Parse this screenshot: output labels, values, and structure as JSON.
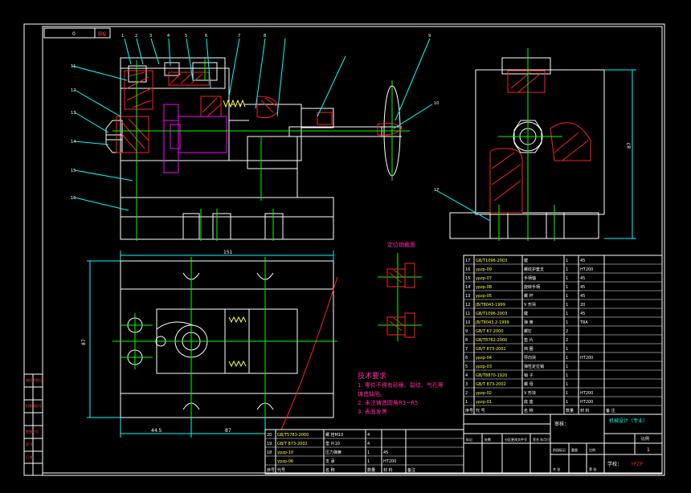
{
  "title_box": {
    "number": "0",
    "label": "图幅"
  },
  "callouts_top": [
    "1",
    "2",
    "3",
    "4",
    "5",
    "6",
    "7",
    "8",
    "9",
    "10",
    "11",
    "12",
    "13",
    "14",
    "15",
    "16",
    "17"
  ],
  "dimensions": {
    "width_main": "151",
    "height_main": "87",
    "height_side": "87",
    "dim_a": "44.5",
    "dim_b": "87"
  },
  "section_label": "定位销截面",
  "tech_req": {
    "title": "技术要求",
    "lines": [
      "1. 零件不得有砂眼、裂纹、气孔等",
      "   铸造缺陷。",
      "2. 未注铸造圆角R3~R5",
      "3. 表面发黑"
    ]
  },
  "parts_table": {
    "rows": [
      [
        "17",
        "GB/T1096-2003",
        "键",
        "1",
        "45",
        ""
      ],
      [
        "16",
        "ypzp-09",
        "螺纹护套支",
        "1",
        "HT200",
        ""
      ],
      [
        "15",
        "ypzp-07",
        "手柄轴",
        "1",
        "45",
        ""
      ],
      [
        "14",
        "ypzp-08",
        "旋转手柄",
        "1",
        "45",
        ""
      ],
      [
        "13",
        "ypzp-05",
        "螺 杆",
        "1",
        "45",
        ""
      ],
      [
        "12",
        "JB/T8043-1999",
        "V 形块",
        "1",
        "20",
        ""
      ],
      [
        "11",
        "GB/T1096-2003",
        "键",
        "1",
        "45",
        ""
      ],
      [
        "10",
        "JB/T8043.2-1999",
        "弹 簧",
        "1",
        "T8A",
        ""
      ],
      [
        "9",
        "GB/T 67-2000",
        "螺钉",
        "2",
        "",
        ""
      ],
      [
        "8",
        "GB/T8782-2000",
        "垫 片",
        "2",
        "",
        ""
      ],
      [
        "7",
        "GB/T 873-2002",
        "挡 圈",
        "1",
        "",
        ""
      ],
      [
        "6",
        "ypzp-04",
        "导向块",
        "1",
        "HT200",
        ""
      ],
      [
        "5",
        "ypzp-03",
        "弹性定位销",
        "1",
        "",
        ""
      ],
      [
        "4",
        "GB/T8870-1920",
        "销 子",
        "1",
        "",
        ""
      ],
      [
        "3",
        "GB/T 873-2002",
        "螺 母",
        "1",
        "",
        ""
      ],
      [
        "2",
        "ypzp-02",
        "V 形块",
        "1",
        "HT200",
        ""
      ],
      [
        "1",
        "ypzp-01",
        "底 座",
        "1",
        "HT200",
        ""
      ]
    ],
    "header": [
      "序号",
      "代 号",
      "名 称",
      "数量",
      "材 料",
      "备 注"
    ]
  },
  "mid_table": {
    "rows": [
      [
        "20",
        "GB/T5783-2000",
        "螺 栓M10",
        "4",
        "",
        ""
      ],
      [
        "19",
        "GB/T 873-2002",
        "垫 片10",
        "4",
        "",
        ""
      ],
      [
        "18",
        "ypzp-10",
        "压力弹簧",
        "1",
        "45",
        ""
      ],
      [
        "",
        "ypzp-06",
        "支 承",
        "1",
        "HT200",
        ""
      ]
    ],
    "footer": [
      "序号",
      "代号",
      "名 称",
      "数量",
      "材 料",
      "备注"
    ]
  },
  "title_block": {
    "designer": "审核：",
    "drawing_name": "机械设计（专业）",
    "scale": "比例",
    "sheet": "1",
    "school": "学校：",
    "code": "YPZP",
    "labels": [
      "标记",
      "处数",
      "分区",
      "更改文件号",
      "签名",
      "年月日"
    ],
    "weight_labels": [
      "阶段标记",
      "重量",
      "比例"
    ],
    "sheet_labels": [
      "共 张",
      "第 张"
    ]
  },
  "left_strip": [
    "借用件登记",
    "",
    "旧底图总号",
    "",
    "底图总号",
    "",
    "签 字",
    "日 期"
  ],
  "colors": {
    "outline": "#ffffff",
    "green": "#00ff00",
    "cyan": "#00ffff",
    "red": "#ff2020",
    "magenta": "#ff00ff",
    "yellow": "#ffff00"
  }
}
